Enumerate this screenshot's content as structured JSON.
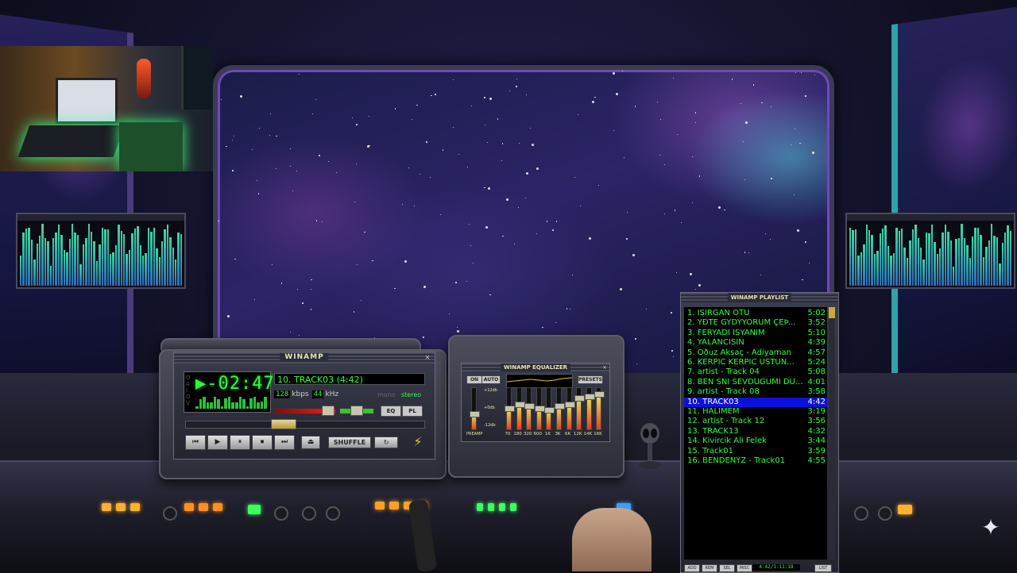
{
  "winamp": {
    "title": "WINAMP",
    "close": "×",
    "side_letters": [
      "O",
      "A",
      "I",
      "D",
      "V"
    ],
    "time": "▶-02:47",
    "track": "10. TRACK03 (4:42)",
    "kbps": "128",
    "kbps_label": "kbps",
    "khz": "44",
    "khz_label": "kHz",
    "mono": "mono",
    "stereo": "stereo",
    "eq_button": "EQ",
    "pl_button": "PL",
    "controls": [
      "⏮",
      "▶",
      "⏸",
      "⏹",
      "⏭"
    ],
    "eject": "⏏",
    "shuffle": "SHUFFLE",
    "repeat": "↻",
    "logo": "⚡"
  },
  "equalizer": {
    "title": "WINAMP EQUALIZER",
    "close": "×",
    "on": "ON",
    "auto": "AUTO",
    "presets": "PRESETS",
    "db_labels": [
      "+12db",
      "+0db",
      "-12db"
    ],
    "preamp": "PREAMP",
    "bands": [
      "70",
      "180",
      "320",
      "600",
      "1K",
      "3K",
      "6K",
      "12K",
      "14K",
      "16K"
    ],
    "levels": [
      0.35,
      0.5,
      0.6,
      0.55,
      0.5,
      0.45,
      0.55,
      0.6,
      0.75,
      0.8,
      0.85
    ]
  },
  "playlist": {
    "title": "WINAMP PLAYLIST",
    "items": [
      {
        "label": "1. ISIRGAN OTU",
        "duration": "5:02"
      },
      {
        "label": "2. YÐTE GYDÝYORUM ÇEÞ...",
        "duration": "3:52"
      },
      {
        "label": "3. FERYADI ISYANIM",
        "duration": "5:10"
      },
      {
        "label": "4. YALANCISIN",
        "duration": "4:39"
      },
      {
        "label": "5. Oðuz Aksaç - Adiyaman",
        "duration": "4:57"
      },
      {
        "label": "6. KERPIC KERPIC USTUN...",
        "duration": "5:24"
      },
      {
        "label": "7. artist - Track 04",
        "duration": "5:08"
      },
      {
        "label": "8. BEN SNI SEVDUGUMI DU...",
        "duration": "4:01"
      },
      {
        "label": "9. artist - Track 08",
        "duration": "3:58"
      },
      {
        "label": "10. TRACK03",
        "duration": "4:42"
      },
      {
        "label": "11. HALIMEM",
        "duration": "3:19"
      },
      {
        "label": "12. artist - Track 12",
        "duration": "3:56"
      },
      {
        "label": "13. TRACK13",
        "duration": "4:32"
      },
      {
        "label": "14. Kivircik Ali Felek",
        "duration": "3:44"
      },
      {
        "label": "15. Track01",
        "duration": "3:59"
      },
      {
        "label": "16. BENDENÝZ - Track01",
        "duration": "4:55"
      }
    ],
    "selected_index": 9,
    "bottom_buttons": [
      "ADD",
      "REM",
      "SEL",
      "MISC"
    ],
    "total_time": "4:42/1:11:18",
    "list_button": "LIST"
  },
  "colors": {
    "lcd_green": "#2cff3c",
    "playlist_selection": "#0a12d8",
    "spectrum_top": "#3fd9a0",
    "spectrum_bottom": "#2a6db8"
  }
}
